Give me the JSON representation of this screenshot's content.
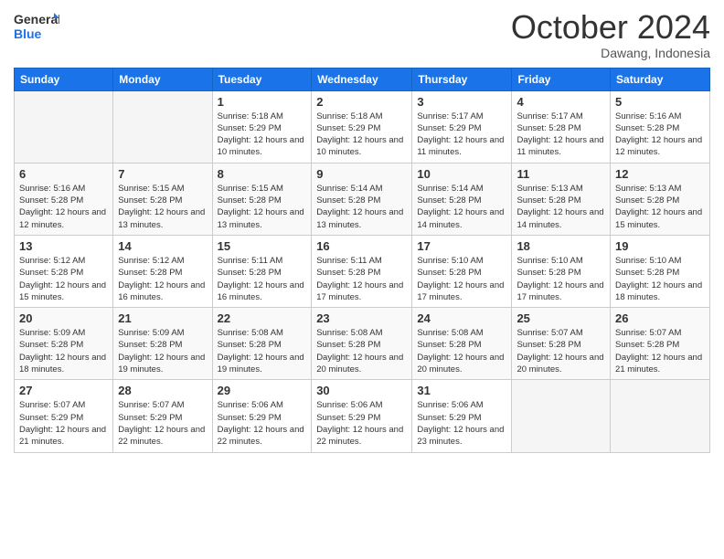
{
  "logo": {
    "line1": "General",
    "line2": "Blue"
  },
  "title": "October 2024",
  "location": "Dawang, Indonesia",
  "days_of_week": [
    "Sunday",
    "Monday",
    "Tuesday",
    "Wednesday",
    "Thursday",
    "Friday",
    "Saturday"
  ],
  "weeks": [
    [
      {
        "day": "",
        "info": ""
      },
      {
        "day": "",
        "info": ""
      },
      {
        "day": "1",
        "info": "Sunrise: 5:18 AM\nSunset: 5:29 PM\nDaylight: 12 hours and 10 minutes."
      },
      {
        "day": "2",
        "info": "Sunrise: 5:18 AM\nSunset: 5:29 PM\nDaylight: 12 hours and 10 minutes."
      },
      {
        "day": "3",
        "info": "Sunrise: 5:17 AM\nSunset: 5:29 PM\nDaylight: 12 hours and 11 minutes."
      },
      {
        "day": "4",
        "info": "Sunrise: 5:17 AM\nSunset: 5:28 PM\nDaylight: 12 hours and 11 minutes."
      },
      {
        "day": "5",
        "info": "Sunrise: 5:16 AM\nSunset: 5:28 PM\nDaylight: 12 hours and 12 minutes."
      }
    ],
    [
      {
        "day": "6",
        "info": "Sunrise: 5:16 AM\nSunset: 5:28 PM\nDaylight: 12 hours and 12 minutes."
      },
      {
        "day": "7",
        "info": "Sunrise: 5:15 AM\nSunset: 5:28 PM\nDaylight: 12 hours and 13 minutes."
      },
      {
        "day": "8",
        "info": "Sunrise: 5:15 AM\nSunset: 5:28 PM\nDaylight: 12 hours and 13 minutes."
      },
      {
        "day": "9",
        "info": "Sunrise: 5:14 AM\nSunset: 5:28 PM\nDaylight: 12 hours and 13 minutes."
      },
      {
        "day": "10",
        "info": "Sunrise: 5:14 AM\nSunset: 5:28 PM\nDaylight: 12 hours and 14 minutes."
      },
      {
        "day": "11",
        "info": "Sunrise: 5:13 AM\nSunset: 5:28 PM\nDaylight: 12 hours and 14 minutes."
      },
      {
        "day": "12",
        "info": "Sunrise: 5:13 AM\nSunset: 5:28 PM\nDaylight: 12 hours and 15 minutes."
      }
    ],
    [
      {
        "day": "13",
        "info": "Sunrise: 5:12 AM\nSunset: 5:28 PM\nDaylight: 12 hours and 15 minutes."
      },
      {
        "day": "14",
        "info": "Sunrise: 5:12 AM\nSunset: 5:28 PM\nDaylight: 12 hours and 16 minutes."
      },
      {
        "day": "15",
        "info": "Sunrise: 5:11 AM\nSunset: 5:28 PM\nDaylight: 12 hours and 16 minutes."
      },
      {
        "day": "16",
        "info": "Sunrise: 5:11 AM\nSunset: 5:28 PM\nDaylight: 12 hours and 17 minutes."
      },
      {
        "day": "17",
        "info": "Sunrise: 5:10 AM\nSunset: 5:28 PM\nDaylight: 12 hours and 17 minutes."
      },
      {
        "day": "18",
        "info": "Sunrise: 5:10 AM\nSunset: 5:28 PM\nDaylight: 12 hours and 17 minutes."
      },
      {
        "day": "19",
        "info": "Sunrise: 5:10 AM\nSunset: 5:28 PM\nDaylight: 12 hours and 18 minutes."
      }
    ],
    [
      {
        "day": "20",
        "info": "Sunrise: 5:09 AM\nSunset: 5:28 PM\nDaylight: 12 hours and 18 minutes."
      },
      {
        "day": "21",
        "info": "Sunrise: 5:09 AM\nSunset: 5:28 PM\nDaylight: 12 hours and 19 minutes."
      },
      {
        "day": "22",
        "info": "Sunrise: 5:08 AM\nSunset: 5:28 PM\nDaylight: 12 hours and 19 minutes."
      },
      {
        "day": "23",
        "info": "Sunrise: 5:08 AM\nSunset: 5:28 PM\nDaylight: 12 hours and 20 minutes."
      },
      {
        "day": "24",
        "info": "Sunrise: 5:08 AM\nSunset: 5:28 PM\nDaylight: 12 hours and 20 minutes."
      },
      {
        "day": "25",
        "info": "Sunrise: 5:07 AM\nSunset: 5:28 PM\nDaylight: 12 hours and 20 minutes."
      },
      {
        "day": "26",
        "info": "Sunrise: 5:07 AM\nSunset: 5:28 PM\nDaylight: 12 hours and 21 minutes."
      }
    ],
    [
      {
        "day": "27",
        "info": "Sunrise: 5:07 AM\nSunset: 5:29 PM\nDaylight: 12 hours and 21 minutes."
      },
      {
        "day": "28",
        "info": "Sunrise: 5:07 AM\nSunset: 5:29 PM\nDaylight: 12 hours and 22 minutes."
      },
      {
        "day": "29",
        "info": "Sunrise: 5:06 AM\nSunset: 5:29 PM\nDaylight: 12 hours and 22 minutes."
      },
      {
        "day": "30",
        "info": "Sunrise: 5:06 AM\nSunset: 5:29 PM\nDaylight: 12 hours and 22 minutes."
      },
      {
        "day": "31",
        "info": "Sunrise: 5:06 AM\nSunset: 5:29 PM\nDaylight: 12 hours and 23 minutes."
      },
      {
        "day": "",
        "info": ""
      },
      {
        "day": "",
        "info": ""
      }
    ]
  ]
}
